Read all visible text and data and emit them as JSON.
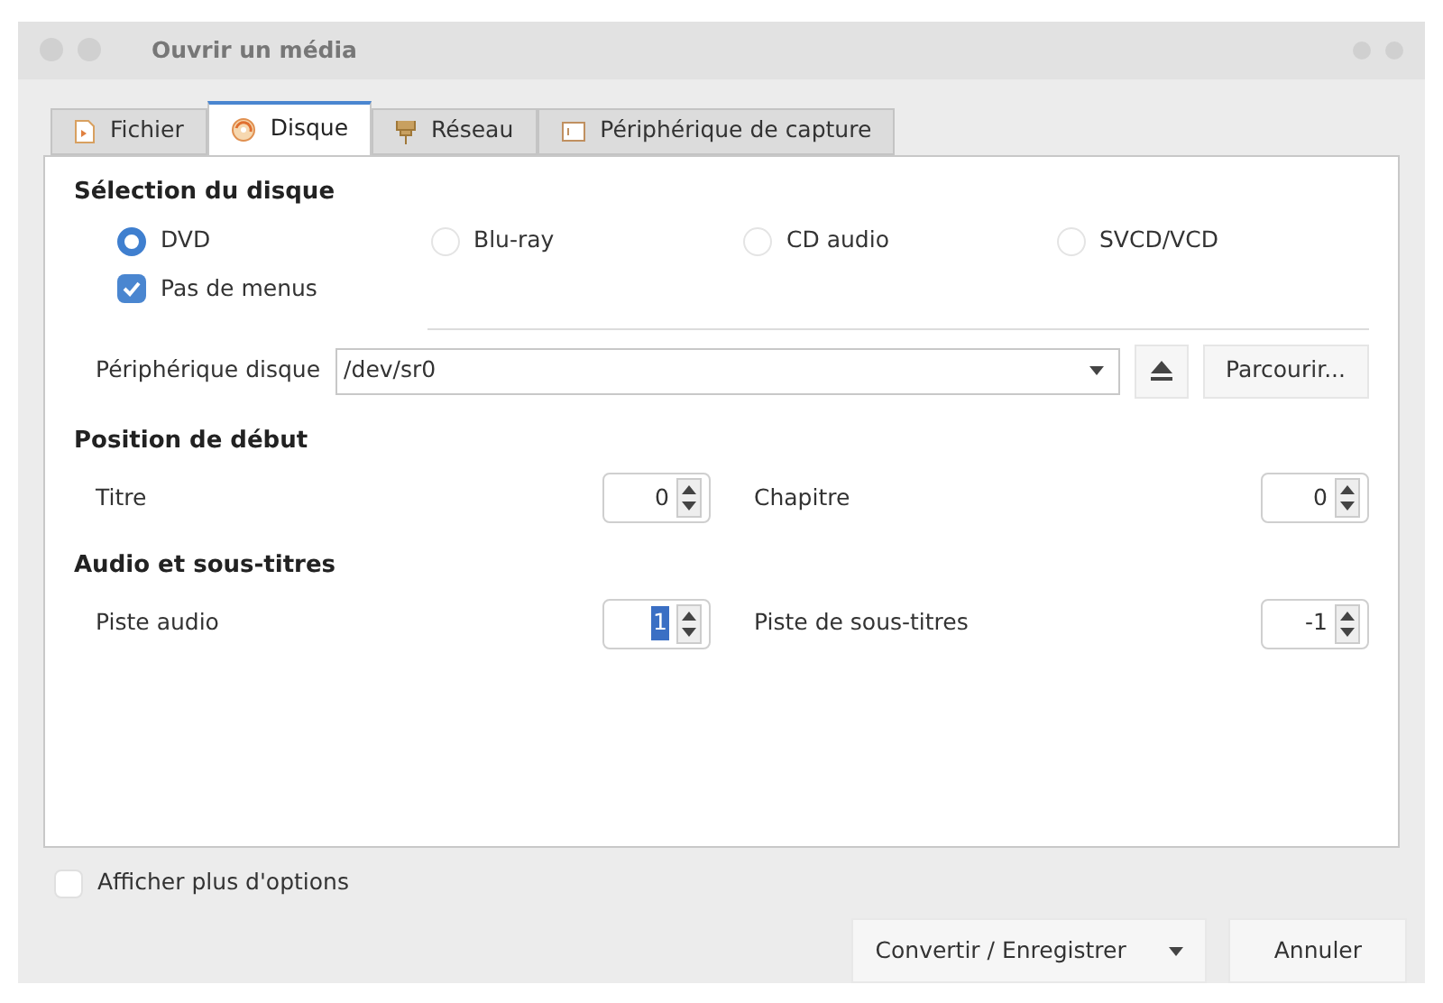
{
  "window": {
    "title": "Ouvrir un média"
  },
  "tabs": [
    {
      "label": "Fichier",
      "kind": "file",
      "selected": false
    },
    {
      "label": "Disque",
      "kind": "disc",
      "selected": true
    },
    {
      "label": "Réseau",
      "kind": "network",
      "selected": false
    },
    {
      "label": "Périphérique de capture",
      "kind": "capture",
      "selected": false
    }
  ],
  "disc_selection": {
    "heading": "Sélection du disque",
    "options": [
      {
        "label": "DVD",
        "selected": true
      },
      {
        "label": "Blu-ray",
        "selected": false
      },
      {
        "label": "CD audio",
        "selected": false
      },
      {
        "label": "SVCD/VCD",
        "selected": false
      }
    ],
    "no_menus": {
      "label": "Pas de menus",
      "checked": true
    },
    "device": {
      "label": "Périphérique disque",
      "value": "/dev/sr0"
    },
    "browse": "Parcourir..."
  },
  "start_position": {
    "heading": "Position de début",
    "fields": [
      {
        "label": "Titre",
        "value": "0",
        "focused": false
      },
      {
        "label": "Chapitre",
        "value": "0",
        "focused": false
      }
    ]
  },
  "audio_subtitles": {
    "heading": "Audio et sous-titres",
    "fields": [
      {
        "label": "Piste audio",
        "value": "1",
        "focused": true
      },
      {
        "label": "Piste de sous-titres",
        "value": "-1",
        "focused": false
      }
    ]
  },
  "show_more": {
    "label": "Afficher plus d'options",
    "checked": false
  },
  "buttons": {
    "convert": "Convertir / Enregistrer",
    "cancel": "Annuler"
  }
}
